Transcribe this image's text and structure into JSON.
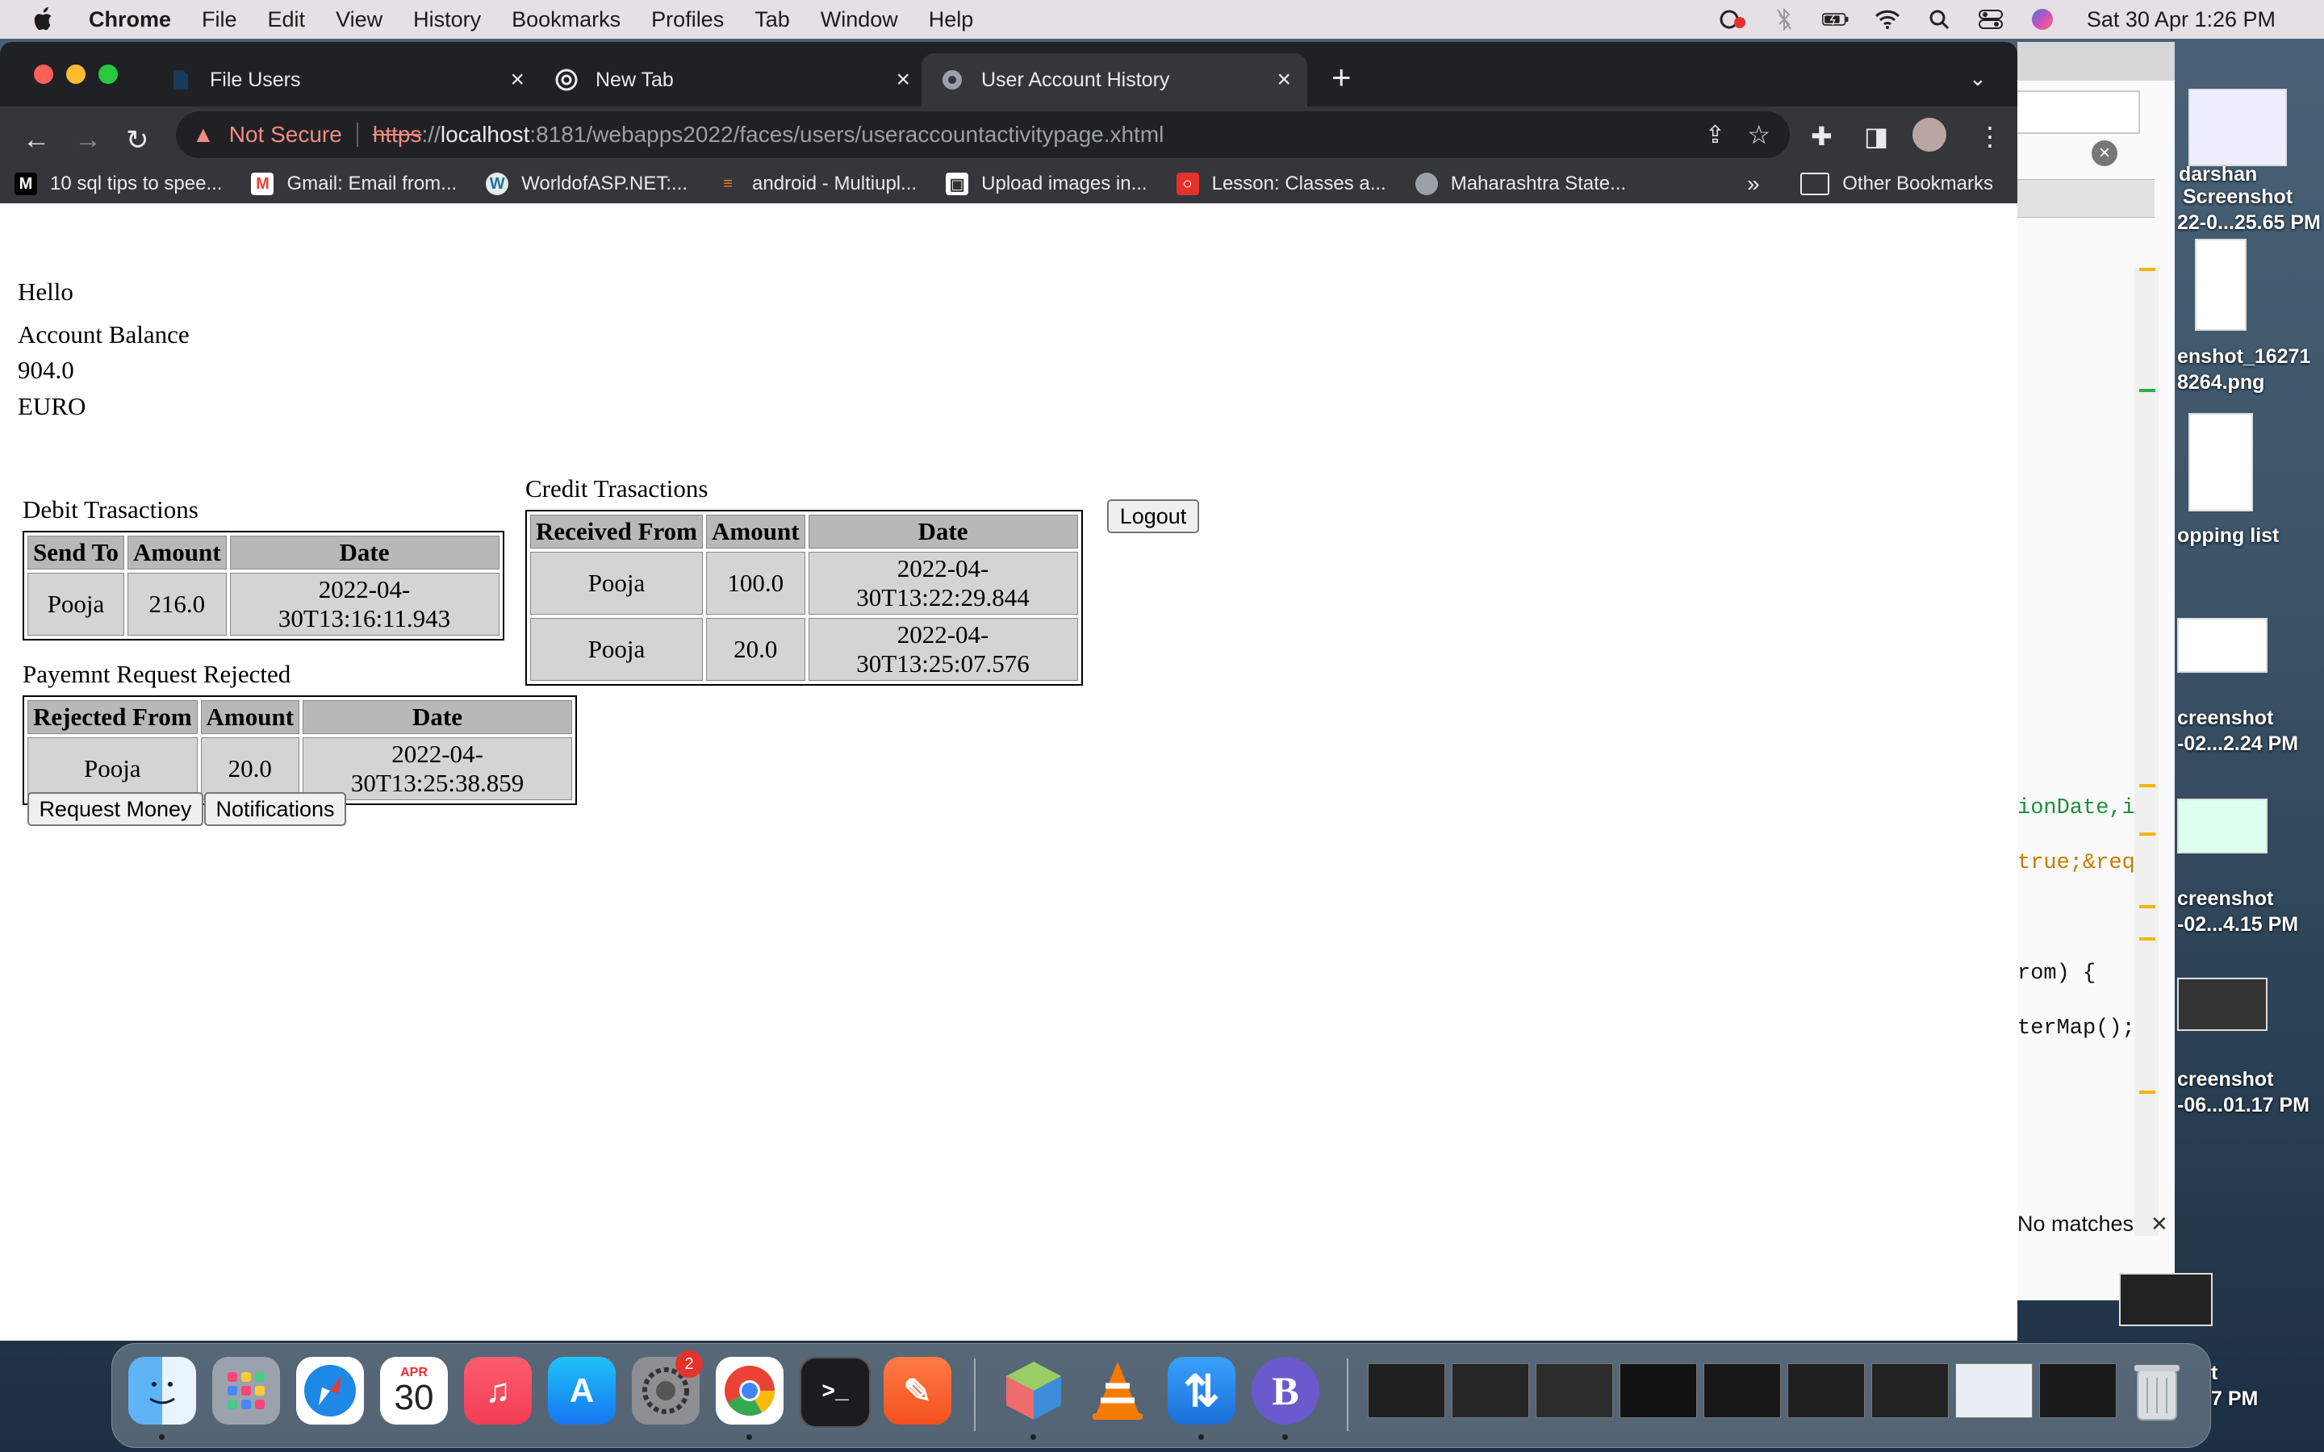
{
  "menubar": {
    "app_name": "Chrome",
    "items": [
      "File",
      "Edit",
      "View",
      "History",
      "Bookmarks",
      "Profiles",
      "Tab",
      "Window",
      "Help"
    ],
    "clock": "Sat 30 Apr  1:26 PM"
  },
  "tabs": [
    {
      "title": "File Users",
      "icon": "file-icon"
    },
    {
      "title": "New Tab",
      "icon": "chrome-icon"
    },
    {
      "title": "User Account History",
      "icon": "globe-icon",
      "active": true
    }
  ],
  "address_bar": {
    "security": "Not Secure",
    "scheme": "https",
    "separator": "://",
    "host": "localhost",
    "path": ":8181/webapps2022/faces/users/useraccountactivitypage.xhtml"
  },
  "bookmarks": [
    {
      "label": "10 sql tips to spee...",
      "icon": "medium-icon"
    },
    {
      "label": "Gmail: Email from...",
      "icon": "gmail-icon"
    },
    {
      "label": "WorldofASP.NET:...",
      "icon": "wordpress-icon"
    },
    {
      "label": "android - Multiupl...",
      "icon": "stackoverflow-icon"
    },
    {
      "label": "Upload images in...",
      "icon": "image-icon"
    },
    {
      "label": "Lesson: Classes a...",
      "icon": "oracle-icon"
    },
    {
      "label": "Maharashtra State...",
      "icon": "globe-icon"
    }
  ],
  "bookmarks_more": "»",
  "other_bookmarks": "Other Bookmarks",
  "page": {
    "greeting": "Hello",
    "balance_label": "Account Balance",
    "balance_value": "904.0",
    "currency": "EURO",
    "debit": {
      "title": "Debit Trasactions",
      "headers": [
        "Send To",
        "Amount",
        "Date"
      ],
      "rows": [
        [
          "Pooja",
          "216.0",
          "2022-04-30T13:16:11.943"
        ]
      ]
    },
    "credit": {
      "title": "Credit Trasactions",
      "headers": [
        "Received From",
        "Amount",
        "Date"
      ],
      "rows": [
        [
          "Pooja",
          "100.0",
          "2022-04-30T13:22:29.844"
        ],
        [
          "Pooja",
          "20.0",
          "2022-04-30T13:25:07.576"
        ]
      ]
    },
    "logout_label": "Logout",
    "rejected": {
      "title": "Payemnt Request Rejected",
      "headers": [
        "Rejected From",
        "Amount",
        "Date"
      ],
      "rows": [
        [
          "Pooja",
          "20.0",
          "2022-04-30T13:25:38.859"
        ]
      ]
    },
    "request_money_label": "Request Money",
    "notifications_label": "Notifications"
  },
  "background_window": {
    "code_lines": [
      "ionDate,i",
      "true;&req",
      "rom) {",
      "terMap();"
    ],
    "find_status": "No matches"
  },
  "desktop_icons": [
    {
      "label_1": "darshan",
      "label_2": ""
    },
    {
      "label_1": "Screenshot",
      "label_2": "22-0...25.65 PM"
    },
    {
      "label_1": "enshot_16271",
      "label_2": "8264.png"
    },
    {
      "label_1": "opping list",
      "label_2": ""
    },
    {
      "label_1": "creenshot",
      "label_2": "-02...2.24 PM"
    },
    {
      "label_1": "creenshot",
      "label_2": "-02...4.15 PM"
    },
    {
      "label_1": "creenshot",
      "label_2": "-06...01.17 PM"
    },
    {
      "label_1": "t",
      "label_2": "7 PM"
    }
  ],
  "dock": {
    "calendar_month": "APR",
    "calendar_day": "30",
    "settings_badge": "2"
  }
}
